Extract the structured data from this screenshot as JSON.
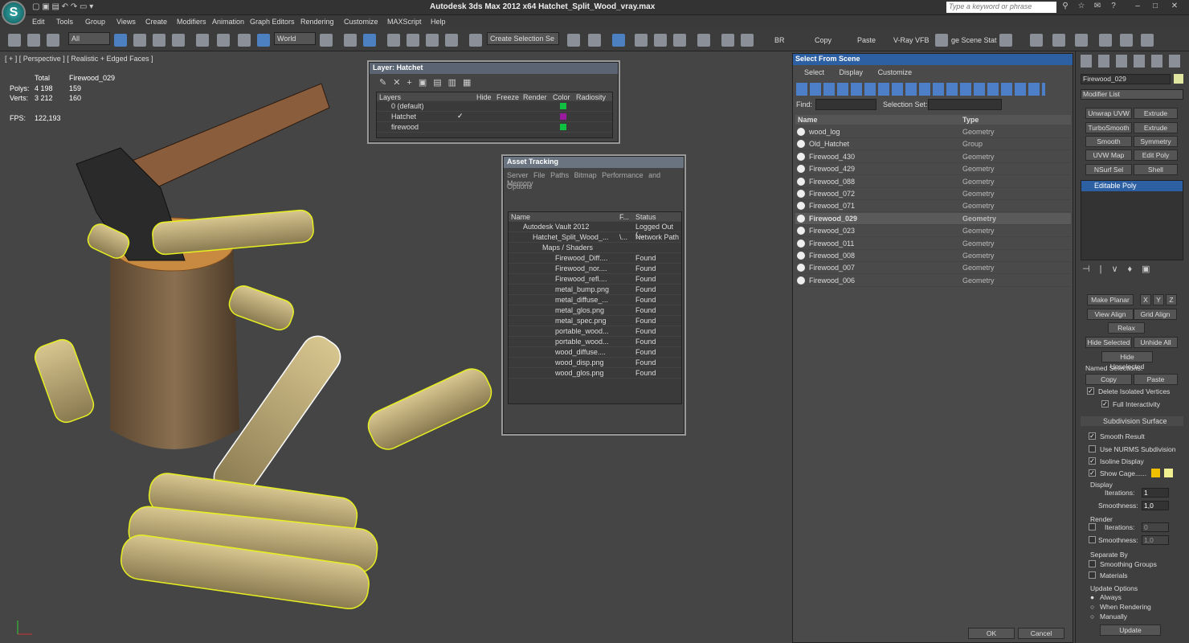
{
  "window": {
    "title": "Autodesk 3ds Max  2012 x64     Hatchet_Split_Wood_vray.max",
    "search_placeholder": "Type a keyword or phrase"
  },
  "menu": [
    "Edit",
    "Tools",
    "Group",
    "Views",
    "Create",
    "Modifiers",
    "Animation",
    "Graph Editors",
    "Rendering",
    "Customize",
    "MAXScript",
    "Help"
  ],
  "toolbar": {
    "filter": "All",
    "coord": "World",
    "selection_set": "Create Selection Se",
    "render_labels": [
      "BR",
      "Copy",
      "Paste",
      "V-Ray VFB",
      "ge Scene Stat"
    ]
  },
  "viewport": {
    "label": "[ + ] [ Perspective ] [ Realistic + Edged Faces ]",
    "stats": {
      "total_label": "Total",
      "object_label": "Firewood_029",
      "polys_label": "Polys:",
      "polys_total": "4 198",
      "polys_obj": "159",
      "verts_label": "Verts:",
      "verts_total": "3 212",
      "verts_obj": "160",
      "fps_label": "FPS:",
      "fps": "122,193"
    }
  },
  "layer_dialog": {
    "title": "Layer: Hatchet",
    "headers": [
      "Layers",
      "Hide",
      "Freeze",
      "Render",
      "Color",
      "Radiosity"
    ],
    "rows": [
      {
        "name": "0 (default)",
        "color": "#10c040"
      },
      {
        "name": "Hatchet",
        "color": "#9a1aa0"
      },
      {
        "name": "firewood",
        "color": "#10c040"
      }
    ]
  },
  "asset_dialog": {
    "title": "Asset Tracking",
    "menu": [
      "Server",
      "File",
      "Paths",
      "Bitmap Performance and Memory",
      "Options"
    ],
    "headers": [
      "Name",
      "F...",
      "Status"
    ],
    "rows": [
      {
        "name": "Autodesk Vault 2012",
        "f": "",
        "status": "Logged Out (..."
      },
      {
        "name": "Hatchet_Split_Wood_...",
        "f": "\\...",
        "status": "Network Path"
      },
      {
        "name": "Maps / Shaders",
        "f": "",
        "status": ""
      },
      {
        "name": "Firewood_Diff....",
        "f": "",
        "status": "Found"
      },
      {
        "name": "Firewood_nor....",
        "f": "",
        "status": "Found"
      },
      {
        "name": "Firewood_refl....",
        "f": "",
        "status": "Found"
      },
      {
        "name": "metal_bump.png",
        "f": "",
        "status": "Found"
      },
      {
        "name": "metal_diffuse_...",
        "f": "",
        "status": "Found"
      },
      {
        "name": "metal_glos.png",
        "f": "",
        "status": "Found"
      },
      {
        "name": "metal_spec.png",
        "f": "",
        "status": "Found"
      },
      {
        "name": "portable_wood...",
        "f": "",
        "status": "Found"
      },
      {
        "name": "portable_wood...",
        "f": "",
        "status": "Found"
      },
      {
        "name": "wood_diffuse....",
        "f": "",
        "status": "Found"
      },
      {
        "name": "wood_disp.png",
        "f": "",
        "status": "Found"
      },
      {
        "name": "wood_glos.png",
        "f": "",
        "status": "Found"
      }
    ]
  },
  "select_dialog": {
    "title": "Select From Scene",
    "menu": [
      "Select",
      "Display",
      "Customize"
    ],
    "find_label": "Find:",
    "selset_label": "Selection Set:",
    "col_name": "Name",
    "col_type": "Type",
    "rows": [
      {
        "name": "wood_log",
        "type": "Geometry"
      },
      {
        "name": "Old_Hatchet",
        "type": "Group"
      },
      {
        "name": "Firewood_430",
        "type": "Geometry"
      },
      {
        "name": "Firewood_429",
        "type": "Geometry"
      },
      {
        "name": "Firewood_088",
        "type": "Geometry"
      },
      {
        "name": "Firewood_072",
        "type": "Geometry"
      },
      {
        "name": "Firewood_071",
        "type": "Geometry"
      },
      {
        "name": "Firewood_029",
        "type": "Geometry",
        "selected": true
      },
      {
        "name": "Firewood_023",
        "type": "Geometry"
      },
      {
        "name": "Firewood_011",
        "type": "Geometry"
      },
      {
        "name": "Firewood_008",
        "type": "Geometry"
      },
      {
        "name": "Firewood_007",
        "type": "Geometry"
      },
      {
        "name": "Firewood_006",
        "type": "Geometry"
      }
    ],
    "ok": "OK",
    "cancel": "Cancel"
  },
  "command_panel": {
    "object_name": "Firewood_029",
    "modifier_list": "Modifier List",
    "mod_buttons": [
      "Unwrap UVW",
      "Extrude",
      "TurboSmooth",
      "Extrude",
      "Smooth",
      "Symmetry",
      "UVW Map",
      "Edit Poly",
      "NSurf Sel",
      "Shell"
    ],
    "stack_item": "Editable Poly",
    "make_planar": "Make Planar",
    "x": "X",
    "y": "Y",
    "z": "Z",
    "view_align": "View Align",
    "grid_align": "Grid Align",
    "relax": "Relax",
    "hide_selected": "Hide Selected",
    "unhide_all": "Unhide All",
    "hide_unselected": "Hide Unselected",
    "named_sel": "Named Selections:",
    "copy": "Copy",
    "paste": "Paste",
    "delete_iso": "Delete Isolated Vertices",
    "full_inter": "Full Interactivity",
    "subdiv_title": "Subdivision Surface",
    "smooth_result": "Smooth Result",
    "nurms": "Use NURMS Subdivision",
    "isoline": "Isoline Display",
    "show_cage": "Show Cage......",
    "display": "Display",
    "iterations": "Iterations:",
    "iter_val": "1",
    "smoothness": "Smoothness:",
    "smooth_val": "1,0",
    "render": "Render",
    "r_iter_val": "0",
    "r_smooth_val": "1,0",
    "separate_by": "Separate By",
    "smoothing_groups": "Smoothing Groups",
    "materials": "Materials",
    "update_options": "Update Options",
    "always": "Always",
    "when_rendering": "When Rendering",
    "manually": "Manually",
    "update": "Update"
  }
}
